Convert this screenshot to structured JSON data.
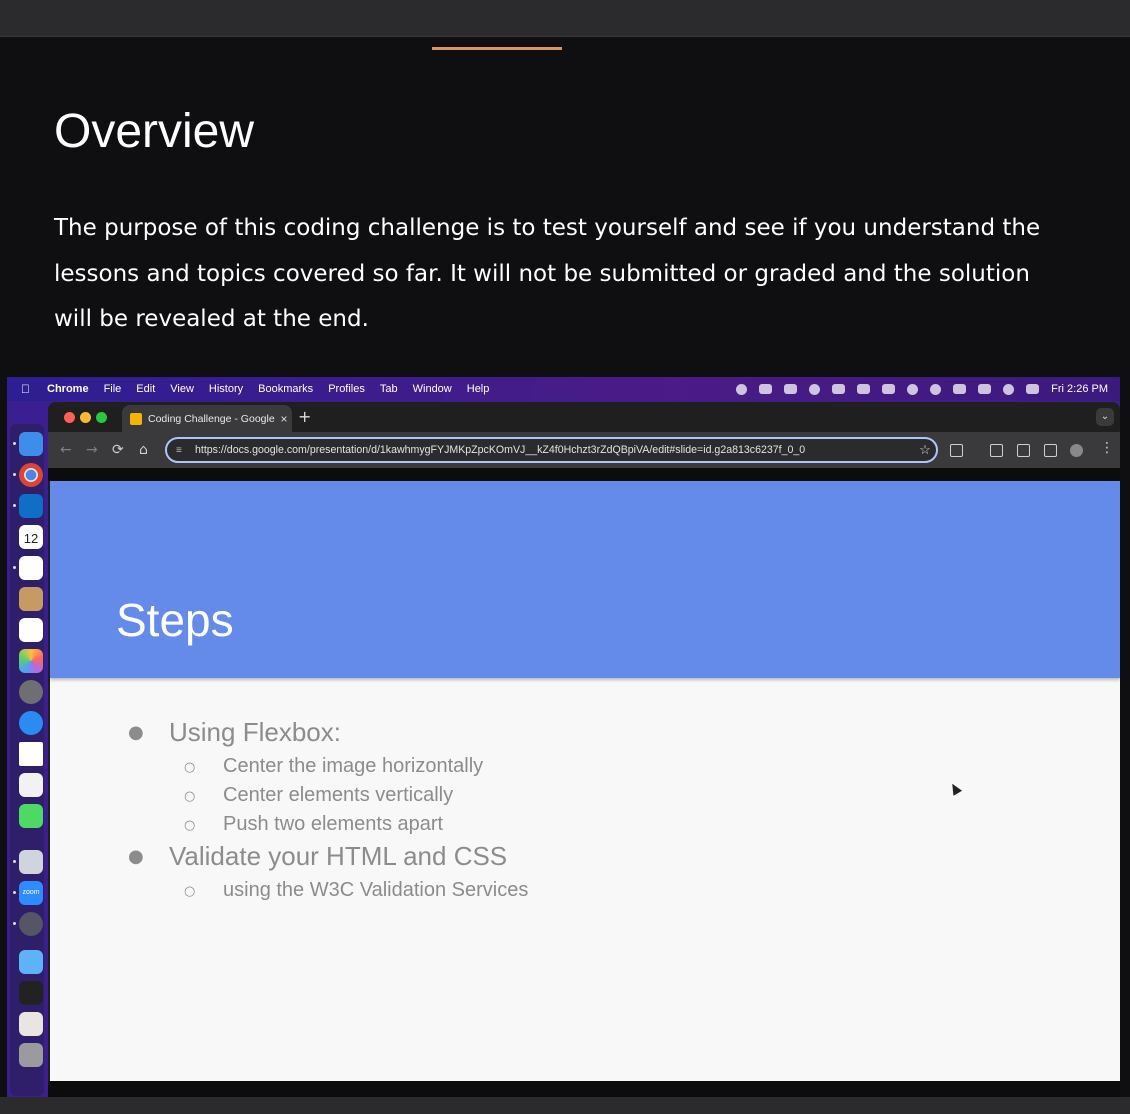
{
  "lesson": {
    "title": "Overview",
    "paragraph": "The purpose of this coding challenge is to test yourself and see if you understand the lessons and topics covered so far. It will not be submitted or graded and the solution will be revealed at the end."
  },
  "menubar": {
    "apple": "",
    "items": [
      "Chrome",
      "File",
      "Edit",
      "View",
      "History",
      "Bookmarks",
      "Profiles",
      "Tab",
      "Window",
      "Help"
    ],
    "clock": "Fri 2:26 PM"
  },
  "dock": {
    "calendar_day": "12",
    "apps": [
      "finder-icon",
      "chrome-icon",
      "vscode-icon",
      "calendar-icon",
      "slack-icon",
      "contacts-icon",
      "reminders-icon",
      "photos-icon",
      "system-settings-icon",
      "safari-icon",
      "full-sail-icon",
      "textedit-icon",
      "messages-icon",
      "preview-icon",
      "zoom-icon",
      "quicktime-icon",
      "folder-icon",
      "terminal-icon",
      "image-file-icon",
      "trash-icon"
    ],
    "zoom_label": "zoom"
  },
  "browser": {
    "tab_title": "Coding Challenge - Google Slides",
    "tab_close": "×",
    "new_tab": "+",
    "url": "https://docs.google.com/presentation/d/1kawhmygFYJMKpZpcKOmVJ__kZ4f0Hchzt3rZdQBpiVA/edit#slide=id.g2a813c6237f_0_0",
    "nav": {
      "back": "←",
      "forward": "→",
      "reload": "⟳",
      "home": "⌂"
    },
    "star": "☆",
    "menu": "⋮",
    "tab_menu": "⌄"
  },
  "slide": {
    "title": "Steps",
    "bullet_mark": "●",
    "sub_mark": "○",
    "items": [
      {
        "text": "Using Flexbox:",
        "subs": [
          "Center the image horizontally",
          "Center elements vertically",
          "Push two elements apart"
        ]
      },
      {
        "text": "Validate your HTML and CSS",
        "subs": [
          "using the W3C Validation Services"
        ]
      }
    ]
  },
  "colors": {
    "background": "#0f0e10",
    "accent_progress": "#d9946a",
    "slide_header": "#648bea",
    "bullet_text": "#8c8c8c"
  }
}
